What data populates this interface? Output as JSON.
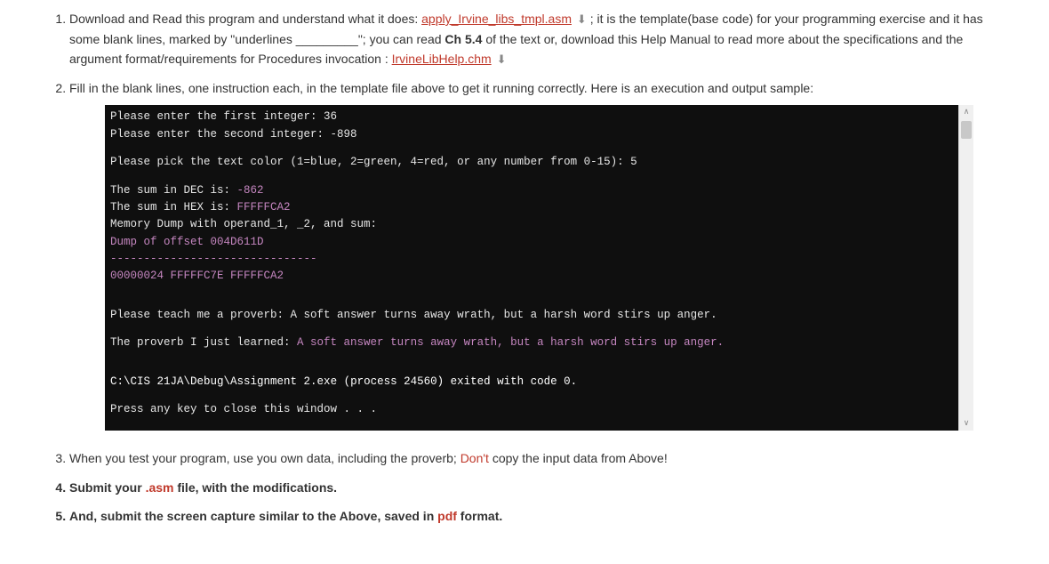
{
  "items": {
    "i1": {
      "pre": "Download and Read this program and understand what it does: ",
      "link1": "apply_Irvine_libs_tmpl.asm",
      "mid1": "  ; it is the template(base code) for your programming exercise and it has some blank lines, marked by \"underlines _________\"; you can read ",
      "bold1": "Ch 5.4",
      "mid2": " of the text or, download this Help Manual to read more about the specifications and the argument format/requirements for Procedures invocation : ",
      "link2": "IrvineLibHelp.chm"
    },
    "i2": "Fill in the blank lines, one instruction each, in the template file above to get it running correctly. Here is an execution and output sample:",
    "i3": {
      "pre": "When you test your program, use you own data, including the proverb; ",
      "red": "Don't",
      "post": " copy the input data from Above!"
    },
    "i4": {
      "pre": "Submit your ",
      "red": ".asm",
      "post": " file, with the modifications."
    },
    "i5": {
      "pre": "And, submit the screen capture similar to the Above, saved in ",
      "red": "pdf",
      "post": " format."
    }
  },
  "console": {
    "l1a": "Please enter the first integer: ",
    "l1b": "36",
    "l2a": "Please enter the second integer: ",
    "l2b": "-898",
    "l3a": "Please pick the text color (1=blue, 2=green, 4=red, or any number from 0-15): ",
    "l3b": "5",
    "l4a": "The sum in DEC is:",
    "l4b": " -862",
    "l5a": "The sum in HEX is: ",
    "l5b": "FFFFFCA2",
    "l6": "Memory Dump with operand_1, _2, and sum:",
    "l7": "Dump of offset 004D611D",
    "l8": "-------------------------------",
    "l9": "00000024  FFFFFC7E  FFFFFCA2",
    "l10a": "Please teach me a proverb: ",
    "l10b": "A soft answer turns away wrath, but a harsh word stirs up anger.",
    "l11a": "The proverb I just learned: ",
    "l11b": "A soft answer turns away wrath, but a harsh word stirs up anger.",
    "l12a": "C:\\",
    "l12b": "CIS ",
    "l12c": "21JA\\Debug\\Assignment 2.exe (process 24560) exited",
    "l12d": " with ",
    "l12e": "code ",
    "l12f": "0.",
    "l13": "Press any key to close this window . . ."
  }
}
